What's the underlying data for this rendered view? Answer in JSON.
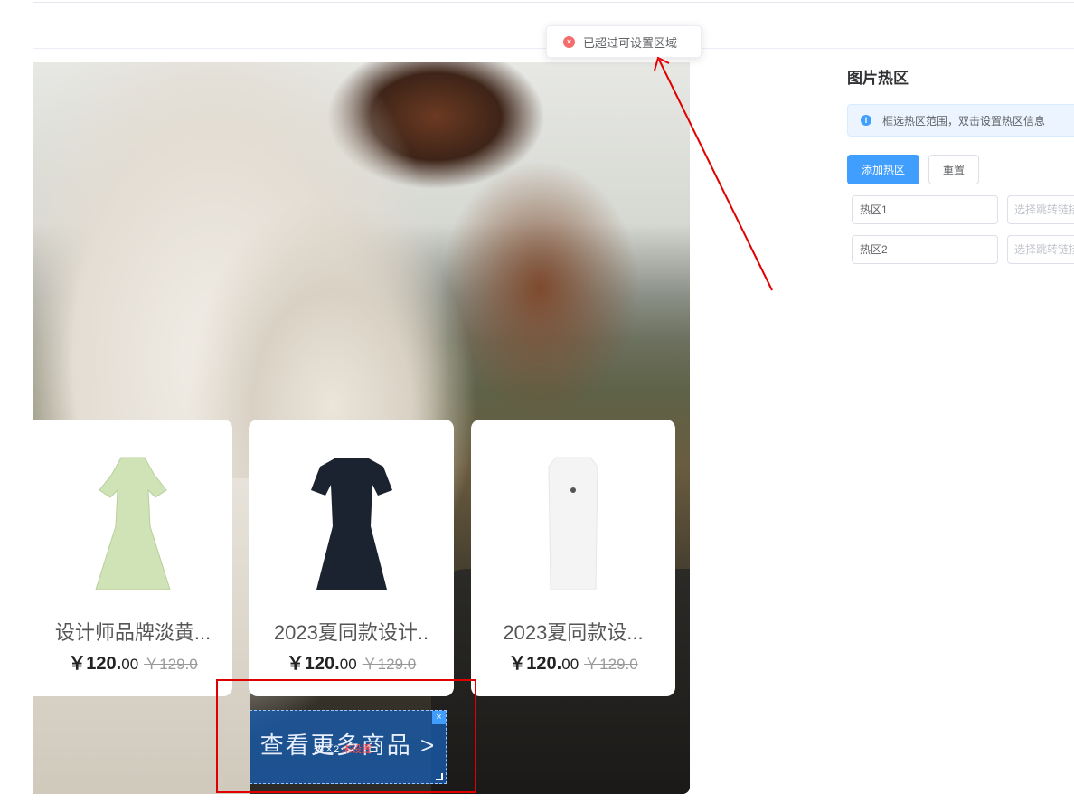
{
  "toast": {
    "message": "已超过可设置区域",
    "type": "error",
    "icon": "error-circle-icon"
  },
  "canvas": {
    "products": [
      {
        "name": "设计师品牌淡黄...",
        "price_int": "￥120.",
        "price_dec": "00",
        "original_price": "￥129.0",
        "garment_color": "#cfe3b6"
      },
      {
        "name": "2023夏同款设计..",
        "price_int": "￥120.",
        "price_dec": "00",
        "original_price": "￥129.0",
        "garment_color": "#1c2330"
      },
      {
        "name": "2023夏同款设...",
        "price_int": "￥120.",
        "price_dec": "00",
        "original_price": "￥129.0",
        "garment_color": "#f4f4f4"
      }
    ],
    "hotspot": {
      "text": "查看更多商品 >",
      "label": "热区2",
      "status": "未设置",
      "close_glyph": "×"
    }
  },
  "panel": {
    "title": "图片热区",
    "info": "框选热区范围，双击设置热区信息",
    "add_button": "添加热区",
    "reset_button": "重置",
    "hotspots": [
      {
        "name": "热区1",
        "link_placeholder": "选择跳转链接"
      },
      {
        "name": "热区2",
        "link_placeholder": "选择跳转链接"
      }
    ]
  },
  "colors": {
    "primary": "#409eff",
    "error": "#f56c6c",
    "annotation_red": "#e00000"
  }
}
